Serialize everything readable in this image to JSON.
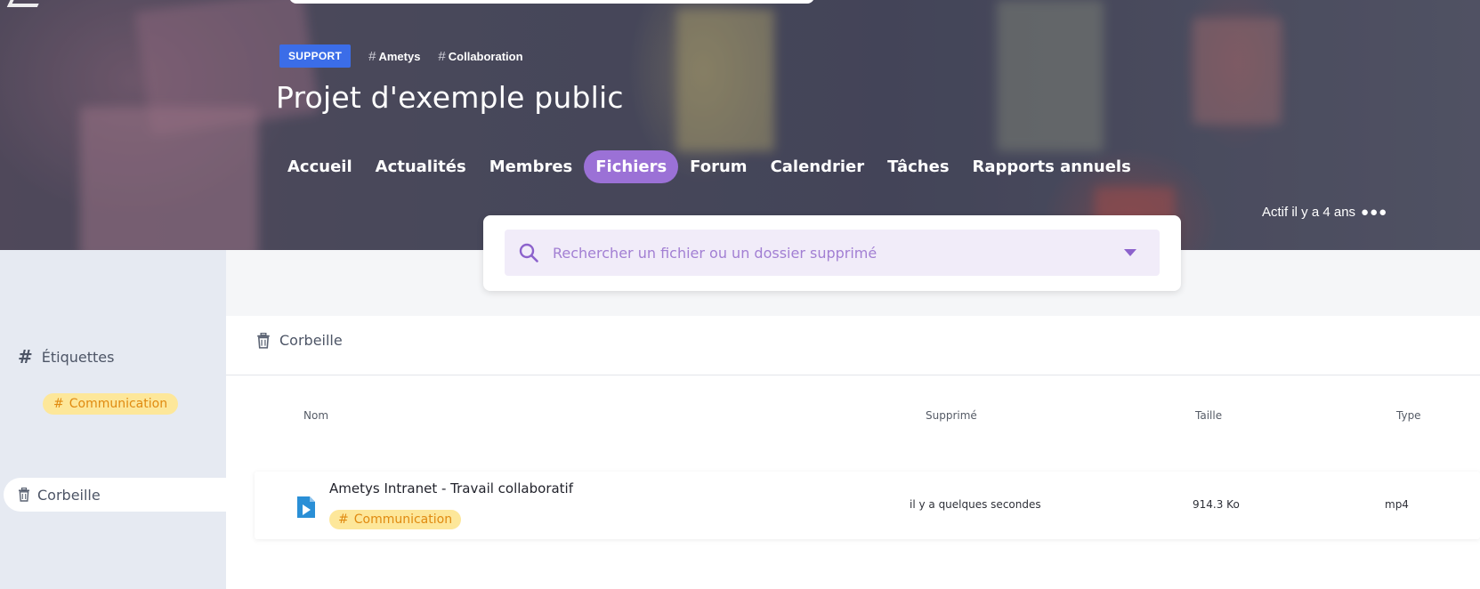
{
  "header": {
    "badge": "SUPPORT",
    "tags": [
      "Ametys",
      "Collaboration"
    ],
    "title": "Projet d'exemple public",
    "nav": [
      {
        "label": "Accueil",
        "active": false
      },
      {
        "label": "Actualités",
        "active": false
      },
      {
        "label": "Membres",
        "active": false
      },
      {
        "label": "Fichiers",
        "active": true
      },
      {
        "label": "Forum",
        "active": false
      },
      {
        "label": "Calendrier",
        "active": false
      },
      {
        "label": "Tâches",
        "active": false
      },
      {
        "label": "Rapports annuels",
        "active": false
      }
    ],
    "activity": "Actif il y a 4 ans",
    "more": "●●●"
  },
  "search": {
    "placeholder": "Rechercher un fichier ou un dossier supprimé",
    "value": ""
  },
  "sidebar": {
    "tags_title": "Étiquettes",
    "tag": "Communication",
    "trash_label": "Corbeille"
  },
  "main": {
    "breadcrumb": "Corbeille",
    "columns": {
      "name": "Nom",
      "deleted": "Supprimé",
      "size": "Taille",
      "type": "Type"
    },
    "files": [
      {
        "name": "Ametys Intranet - Travail collaboratif",
        "tag": "Communication",
        "deleted": "il y a quelques secondes",
        "size": "914.3 Ko",
        "type": "mp4"
      }
    ]
  },
  "colors": {
    "accent": "#9b71d6",
    "badge": "#3b6de8",
    "tag_bg": "#fde79a",
    "tag_text": "#e08a10",
    "video_icon": "#2a8fd6"
  }
}
